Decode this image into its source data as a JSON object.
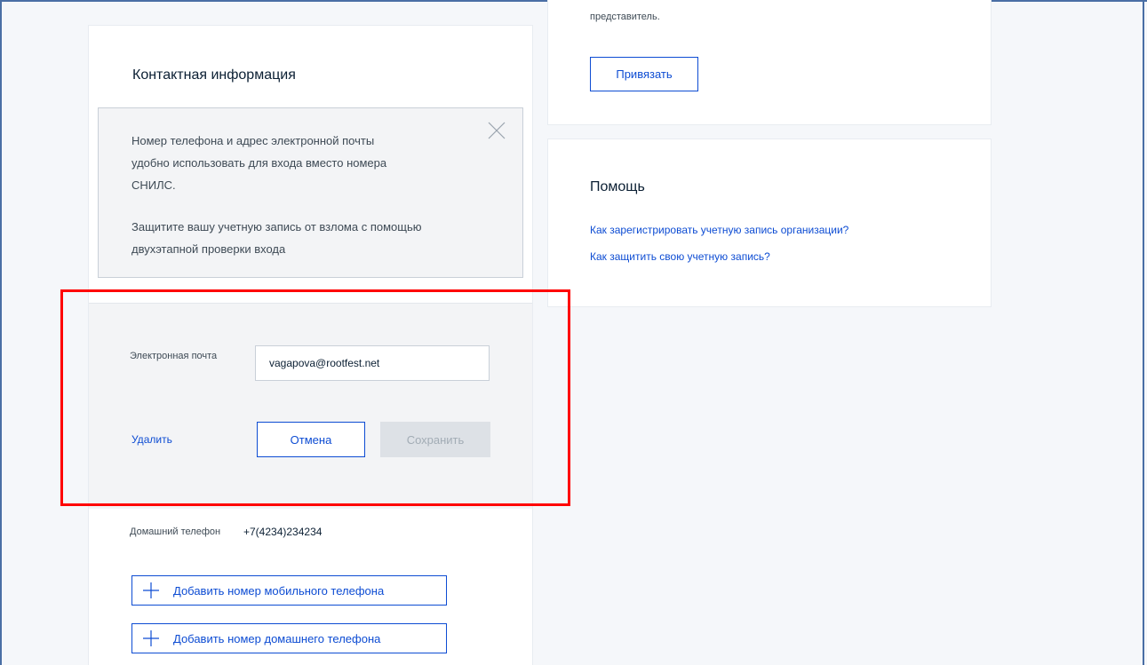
{
  "contact": {
    "title": "Контактная информация",
    "info_paragraph_1_line_1": "Номер телефона и адрес электронной почты",
    "info_paragraph_1_line_2": "удобно использовать для входа вместо номера",
    "info_paragraph_1_line_3": "СНИЛС.",
    "info_paragraph_2_line_1": "Защитите вашу учетную запись от взлома с помощью",
    "info_paragraph_2_line_2": "двухэтапной проверки входа",
    "email_label": "Электронная почта",
    "email_value": "vagapova@rootfest.net",
    "delete_label": "Удалить",
    "cancel_label": "Отмена",
    "save_label": "Сохранить",
    "home_phone_label": "Домашний телефон",
    "home_phone_value": "+7(4234)234234",
    "add_mobile_label": "Добавить номер мобильного телефона",
    "add_home_label": "Добавить номер домашнего телефона"
  },
  "representative": {
    "text": "представитель.",
    "bind_label": "Привязать"
  },
  "help": {
    "title": "Помощь",
    "link_1": "Как зарегистрировать учетную запись организации?",
    "link_2": "Как защитить свою учетную запись?"
  },
  "colors": {
    "accent": "#0d4cd3",
    "highlight": "#ff0000",
    "disabled_bg": "#dde1e6"
  },
  "icons": {
    "close": "close-icon",
    "plus": "plus-icon"
  }
}
